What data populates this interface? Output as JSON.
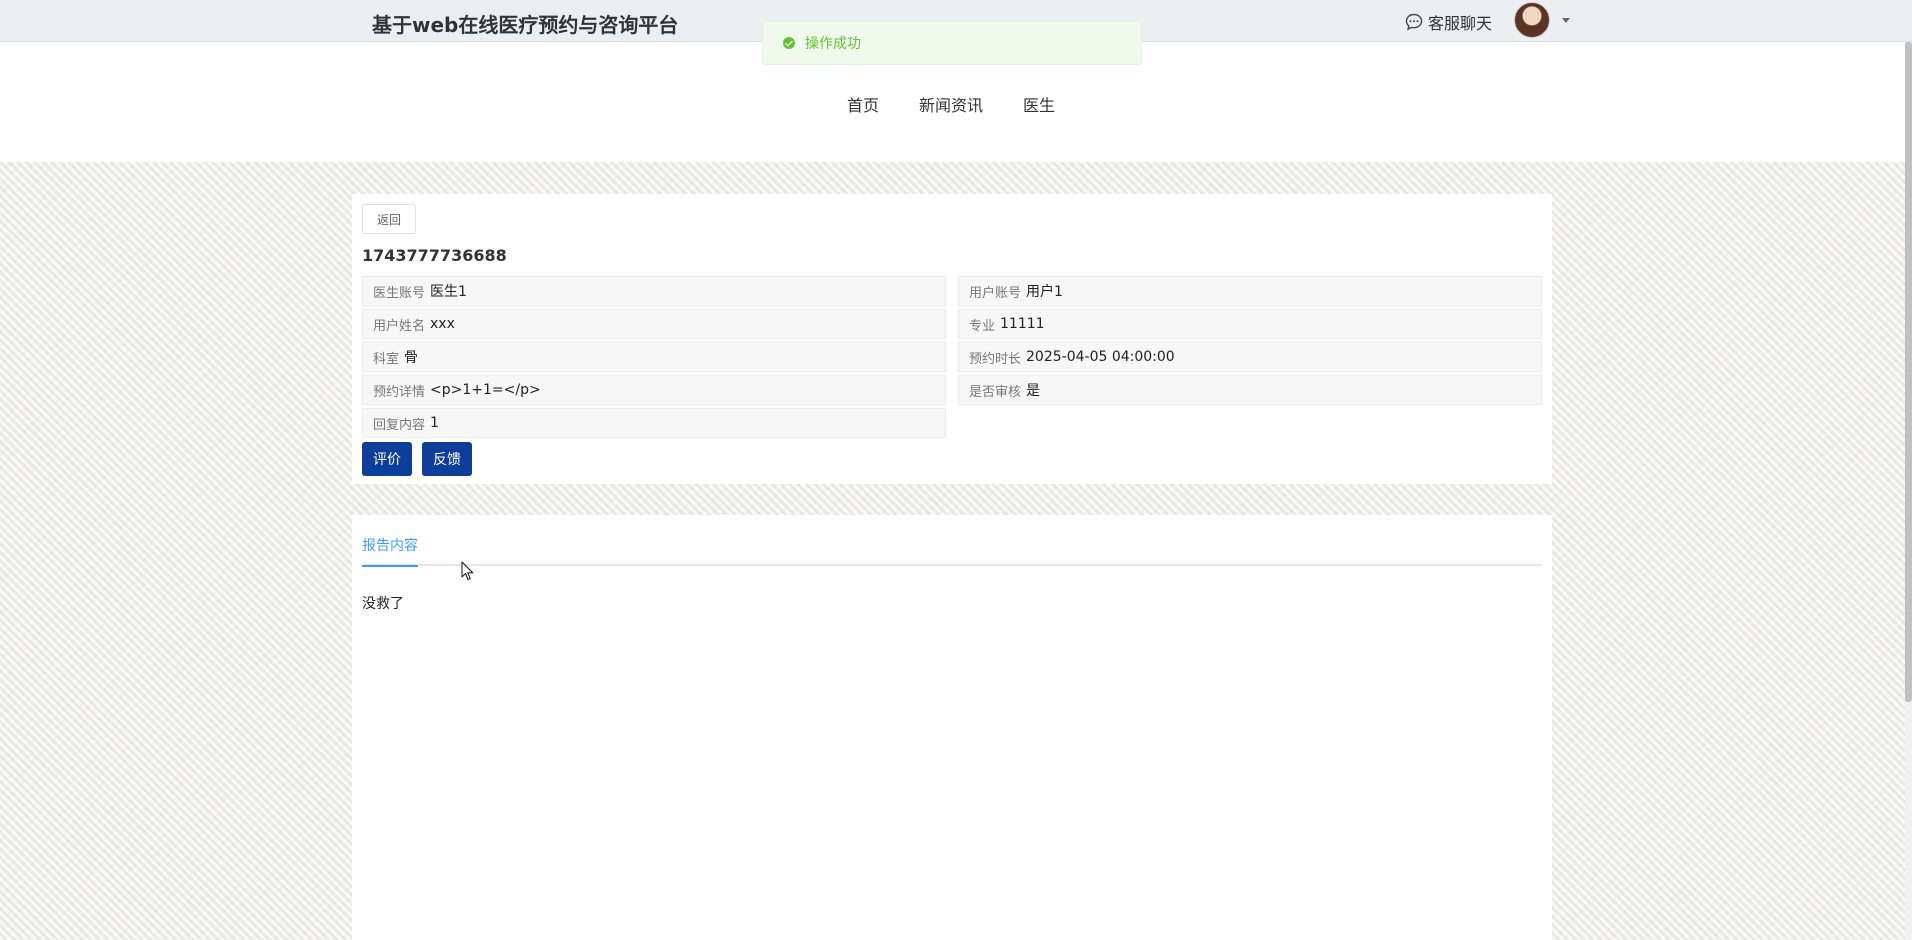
{
  "header": {
    "site_title": "基于web在线医疗预约与咨询平台",
    "chat_label": "客服聊天",
    "chat_icon": "chat-bubble-icon",
    "avatar_icon": "user-avatar"
  },
  "toast": {
    "message": "操作成功",
    "color": "#67c23a"
  },
  "nav": {
    "items": [
      {
        "label": "首页"
      },
      {
        "label": "新闻资讯"
      },
      {
        "label": "医生"
      }
    ]
  },
  "detail": {
    "back_label": "返回",
    "order_no": "1743777736688",
    "fields": [
      {
        "label": "医生账号",
        "value": "医生1"
      },
      {
        "label": "用户账号",
        "value": "用户1"
      },
      {
        "label": "用户姓名",
        "value": "xxx"
      },
      {
        "label": "专业",
        "value": "11111"
      },
      {
        "label": "科室",
        "value": "骨"
      },
      {
        "label": "预约时长",
        "value": "2025-04-05 04:00:00"
      },
      {
        "label": "预约详情",
        "value": "<p>1+1=</p>"
      },
      {
        "label": "是否审核",
        "value": "是"
      },
      {
        "label": "回复内容",
        "value": "1"
      }
    ],
    "buttons": [
      {
        "label": "评价"
      },
      {
        "label": "反馈"
      }
    ],
    "button_color": "#0e3d9a"
  },
  "report": {
    "tab_label": "报告内容",
    "content": "没救了",
    "accent": "#409eff"
  }
}
